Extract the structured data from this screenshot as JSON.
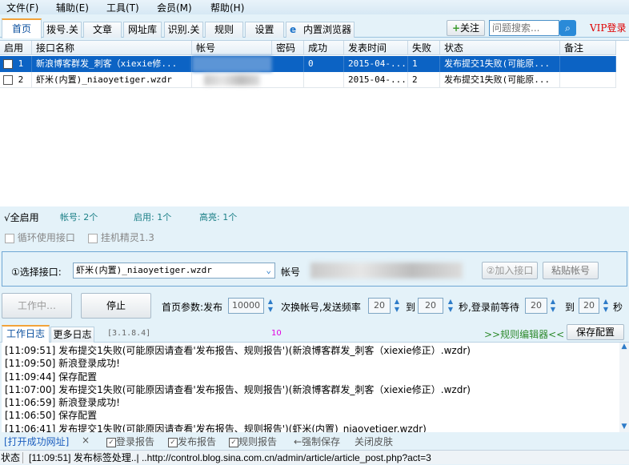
{
  "menu": [
    "文件(F)",
    "辅助(E)",
    "工具(T)",
    "会员(M)",
    "帮助(H)"
  ],
  "tabs": [
    "首页",
    "拨号.关",
    "文章",
    "网址库",
    "识别.关",
    "规则",
    "设置",
    "内置浏览器"
  ],
  "follow_label": "关注",
  "search_placeholder": "问题搜索...",
  "vip_login": "VIP登录",
  "columns": [
    "启用",
    "接口名称",
    "帐号",
    "密码",
    "成功",
    "发表时间",
    "失败",
    "状态",
    "备注"
  ],
  "rows": [
    {
      "checked": true,
      "num": "1",
      "name": "新浪博客群发_刺客（xiexie修...",
      "password": "",
      "success": "0",
      "time": "2015-04-...",
      "fail": "1",
      "status": "发布提交1失败(可能原...",
      "note": ""
    },
    {
      "checked": false,
      "num": "2",
      "name": "虾米(内置)_niaoyetiger.wzdr",
      "password": "",
      "success": "",
      "time": "2015-04-...",
      "fail": "2",
      "status": "发布提交1失败(可能原...",
      "note": ""
    }
  ],
  "summary": {
    "enable_all": "√全启用",
    "accounts": "帐号: 2个",
    "enabled": "启用: 1个",
    "highlight": "高亮: 1个"
  },
  "options": {
    "loop": "循环使用接口",
    "hangup": "挂机精灵1.3"
  },
  "select_interface": {
    "label": "①选择接口:",
    "value": "虾米(内置)_niaoyetiger.wzdr",
    "account_label": "帐号",
    "add_button": "②加入接口",
    "paste_button": "粘贴帐号"
  },
  "work": {
    "working": "工作中…",
    "stop": "停止",
    "p1": "首页参数:发布",
    "publish_count": "10000",
    "p2": "次换帐号,发送频率",
    "freq_from": "20",
    "to1": "到",
    "freq_to": "20",
    "p3": "秒,登录前等待",
    "wait_from": "20",
    "to2": "到",
    "wait_to": "20",
    "sec": "秒"
  },
  "log_tabs": {
    "work_log": "工作日志",
    "more_log": "更多日志",
    "version": "[3.1.8.4]",
    "count": "10",
    "rule_editor": ">>规则编辑器<<",
    "save_config": "保存配置"
  },
  "log_lines": [
    "[11:09:51] 发布提交1失败(可能原因请查看'发布报告、规则报告')(新浪博客群发_刺客（xiexie修正）.wzdr)",
    "[11:09:50] 新浪登录成功!",
    "[11:09:44] 保存配置",
    "[11:07:00] 发布提交1失败(可能原因请查看'发布报告、规则报告')(新浪博客群发_刺客（xiexie修正）.wzdr)",
    "[11:06:59] 新浪登录成功!",
    "[11:06:50] 保存配置",
    "[11:06:41] 发布提交1失败(可能原因请查看'发布报告、规则报告')(虾米(内置)_niaoyetiger.wzdr)"
  ],
  "bottom": {
    "open_url": "[打开成功网址]",
    "close": "×",
    "login_report": "登录报告",
    "publish_report": "发布报告",
    "rule_report": "规则报告",
    "force_save": "←强制保存",
    "close_skin": "关闭皮肤"
  },
  "statusbar": {
    "label": "状态",
    "text": "[11:09:51] 发布标签处理..| ..http://control.blog.sina.com.cn/admin/article/article_post.php?act=3"
  },
  "colors": {
    "selected_row": "#0c63c4",
    "vip": "#e00000",
    "rule_editor": "#2e8b2e",
    "count": "#e000e0"
  }
}
